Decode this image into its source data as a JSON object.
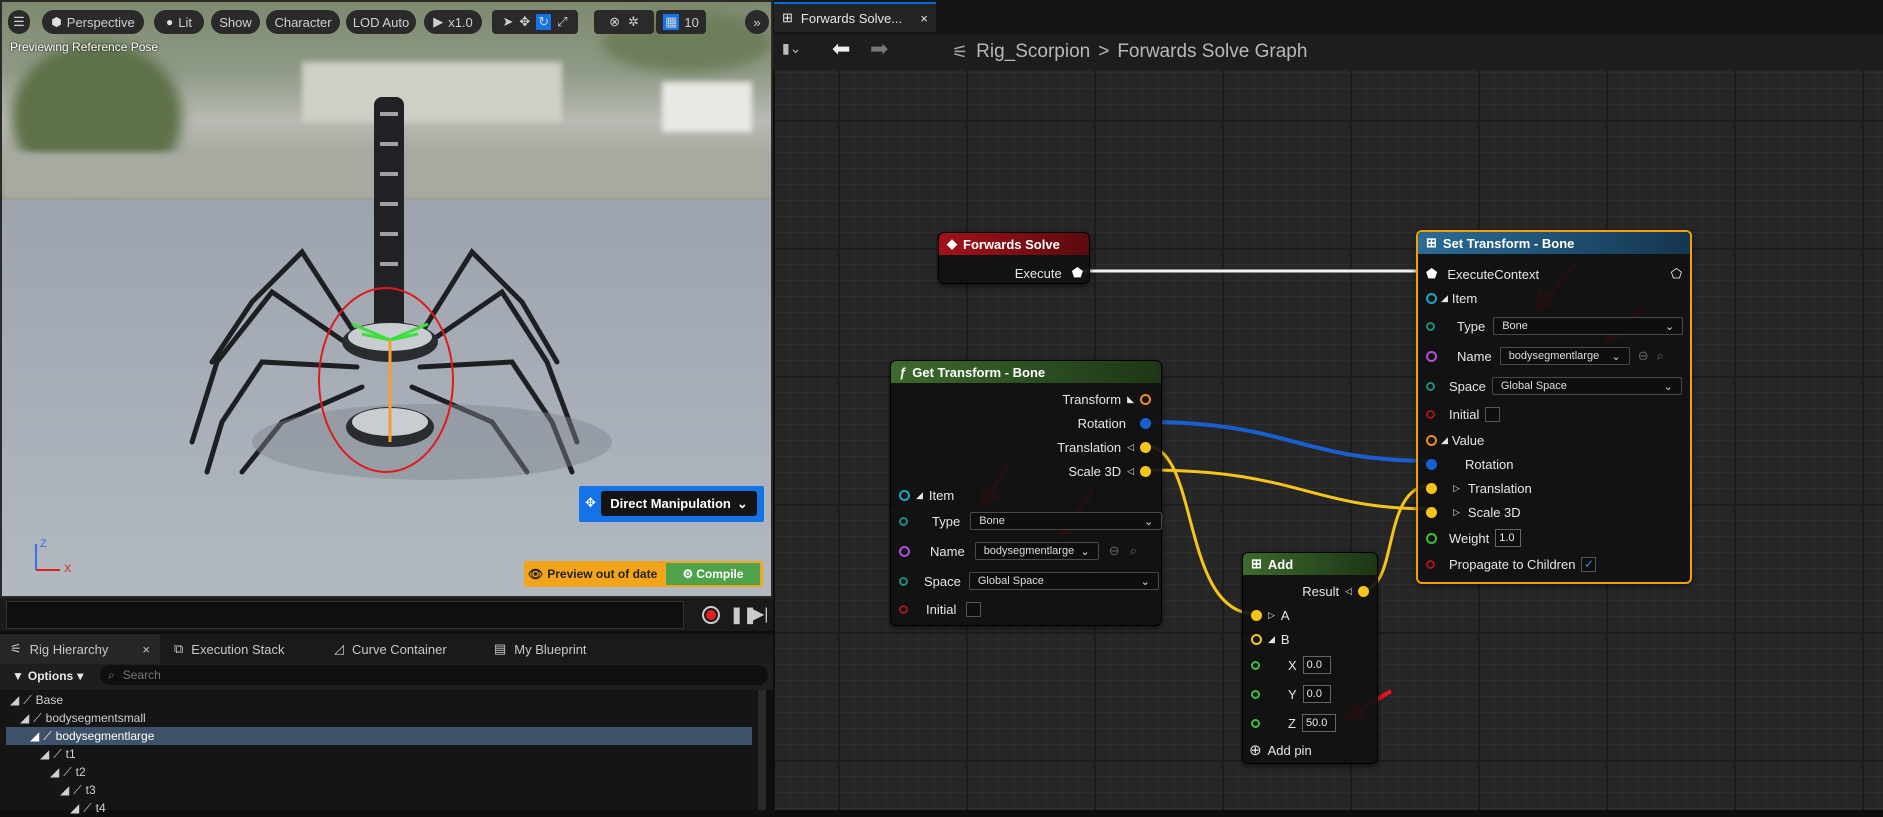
{
  "viewport": {
    "toolbar": {
      "menu_icon": "hamburger-icon",
      "perspective": "Perspective",
      "lit": "Lit",
      "show": "Show",
      "character": "Character",
      "lod": "LOD Auto",
      "play_speed": "x1.0",
      "grid_size": "10"
    },
    "preview_label": "Previewing Reference Pose",
    "direct_manipulation": "Direct Manipulation",
    "preview_out_of_date": "Preview out of date",
    "compile": "Compile",
    "axis": {
      "z": "Z",
      "x": "X"
    }
  },
  "bottom_panel": {
    "tabs": [
      {
        "label": "Rig Hierarchy"
      },
      {
        "label": "Execution Stack"
      },
      {
        "label": "Curve Container"
      },
      {
        "label": "My Blueprint"
      }
    ],
    "options": "Options",
    "search_placeholder": "Search",
    "tree": [
      "Base",
      "bodysegmentsmall",
      "bodysegmentlarge",
      "t1",
      "t2",
      "t3",
      "t4"
    ]
  },
  "graph": {
    "doc_tab": "Forwards Solve...",
    "breadcrumb": {
      "root": "Rig_Scorpion",
      "separator": ">",
      "current": "Forwards Solve Graph"
    },
    "forwards_solve": {
      "title": "Forwards Solve",
      "execute": "Execute"
    },
    "get_transform": {
      "title": "Get Transform - Bone",
      "transform": "Transform",
      "rotation": "Rotation",
      "translation": "Translation",
      "scale": "Scale 3D",
      "item": "Item",
      "type_label": "Type",
      "type_value": "Bone",
      "name_label": "Name",
      "name_value": "bodysegmentlarge",
      "space_label": "Space",
      "space_value": "Global Space",
      "initial": "Initial"
    },
    "add": {
      "title": "Add",
      "result": "Result",
      "a": "A",
      "b": "B",
      "x_label": "X",
      "x_value": "0.0",
      "y_label": "Y",
      "y_value": "0.0",
      "z_label": "Z",
      "z_value": "50.0",
      "add_pin": "Add pin"
    },
    "set_transform": {
      "title": "Set Transform - Bone",
      "execute_context": "ExecuteContext",
      "item": "Item",
      "type_label": "Type",
      "type_value": "Bone",
      "name_label": "Name",
      "name_value": "bodysegmentlarge",
      "space_label": "Space",
      "space_value": "Global Space",
      "initial": "Initial",
      "value": "Value",
      "rotation": "Rotation",
      "translation": "Translation",
      "scale": "Scale 3D",
      "weight_label": "Weight",
      "weight_value": "1.0",
      "propagate": "Propagate to Children"
    }
  },
  "colors": {
    "accent_blue": "#1473e6",
    "selection_orange": "#f5a000",
    "compile_green": "#4ea24a",
    "annotation_red": "#e8141a",
    "vector_pin": "#f7c41a",
    "rotator_pin": "#1a5fd0"
  }
}
